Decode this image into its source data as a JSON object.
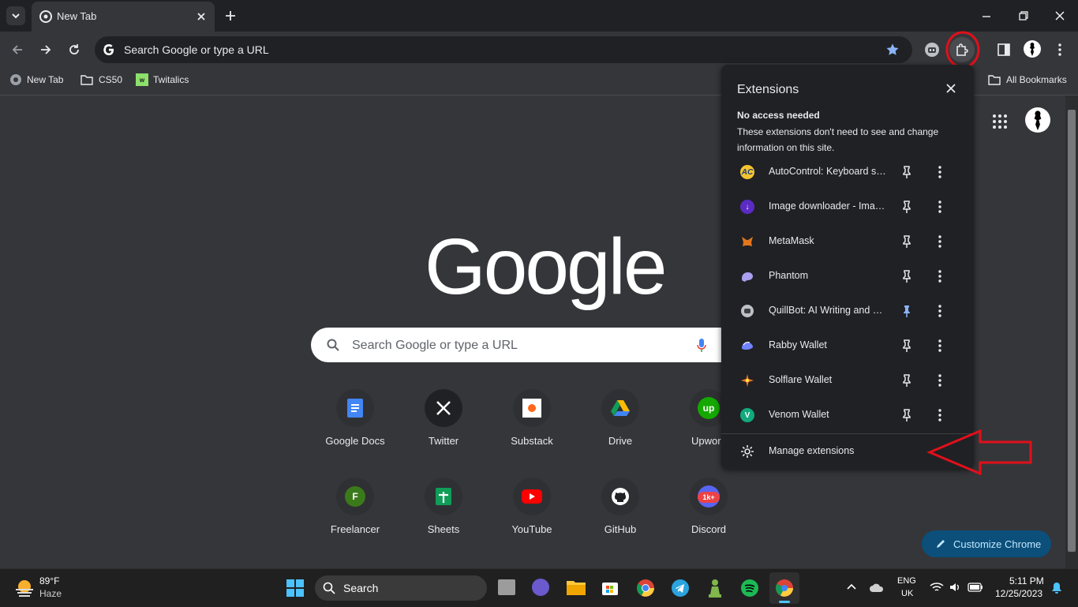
{
  "tabstrip": {
    "tab_title": "New Tab"
  },
  "toolbar": {
    "omnibox_text": "Search Google or type a URL"
  },
  "bookmarks": {
    "items": [
      "New Tab",
      "CS50",
      "Twitalics"
    ],
    "all_bookmarks": "All Bookmarks"
  },
  "page": {
    "logo": "Google",
    "search_placeholder": "Search Google or type a URL",
    "shortcuts": [
      {
        "label": "Google Docs",
        "icon": "google-docs-icon"
      },
      {
        "label": "Twitter",
        "icon": "x-icon"
      },
      {
        "label": "Substack",
        "icon": "substack-icon"
      },
      {
        "label": "Drive",
        "icon": "drive-icon"
      },
      {
        "label": "Upwork",
        "icon": "upwork-icon"
      },
      {
        "label": "Freelancer",
        "icon": "freelancer-icon"
      },
      {
        "label": "Sheets",
        "icon": "sheets-icon"
      },
      {
        "label": "YouTube",
        "icon": "youtube-icon"
      },
      {
        "label": "GitHub",
        "icon": "github-icon"
      },
      {
        "label": "Discord",
        "icon": "discord-icon"
      }
    ],
    "freelancer_letter": "F",
    "discord_badge": "1k+",
    "customize_label": "Customize Chrome"
  },
  "extensions": {
    "title": "Extensions",
    "subhead": "No access needed",
    "description": "These extensions don't need to see and change information on this site.",
    "items": [
      {
        "name": "AutoControl: Keyboard sh...",
        "icon_text": "AC",
        "pinned": false
      },
      {
        "name": "Image downloader - Imag...",
        "icon_text": "↓",
        "pinned": false
      },
      {
        "name": "MetaMask",
        "icon_text": "",
        "pinned": false
      },
      {
        "name": "Phantom",
        "icon_text": "",
        "pinned": false
      },
      {
        "name": "QuillBot: AI Writing and Gr...",
        "icon_text": "",
        "pinned": true
      },
      {
        "name": "Rabby Wallet",
        "icon_text": "",
        "pinned": false
      },
      {
        "name": "Solflare Wallet",
        "icon_text": "",
        "pinned": false
      },
      {
        "name": "Venom Wallet",
        "icon_text": "V",
        "pinned": false
      }
    ],
    "manage_label": "Manage extensions"
  },
  "taskbar": {
    "weather_temp": "89°F",
    "weather_desc": "Haze",
    "search_label": "Search",
    "lang_top": "ENG",
    "lang_bottom": "UK",
    "time": "5:11 PM",
    "date": "12/25/2023"
  },
  "colors": {
    "accent_red": "#e0101a",
    "accent_blue": "#8ab4f8"
  }
}
